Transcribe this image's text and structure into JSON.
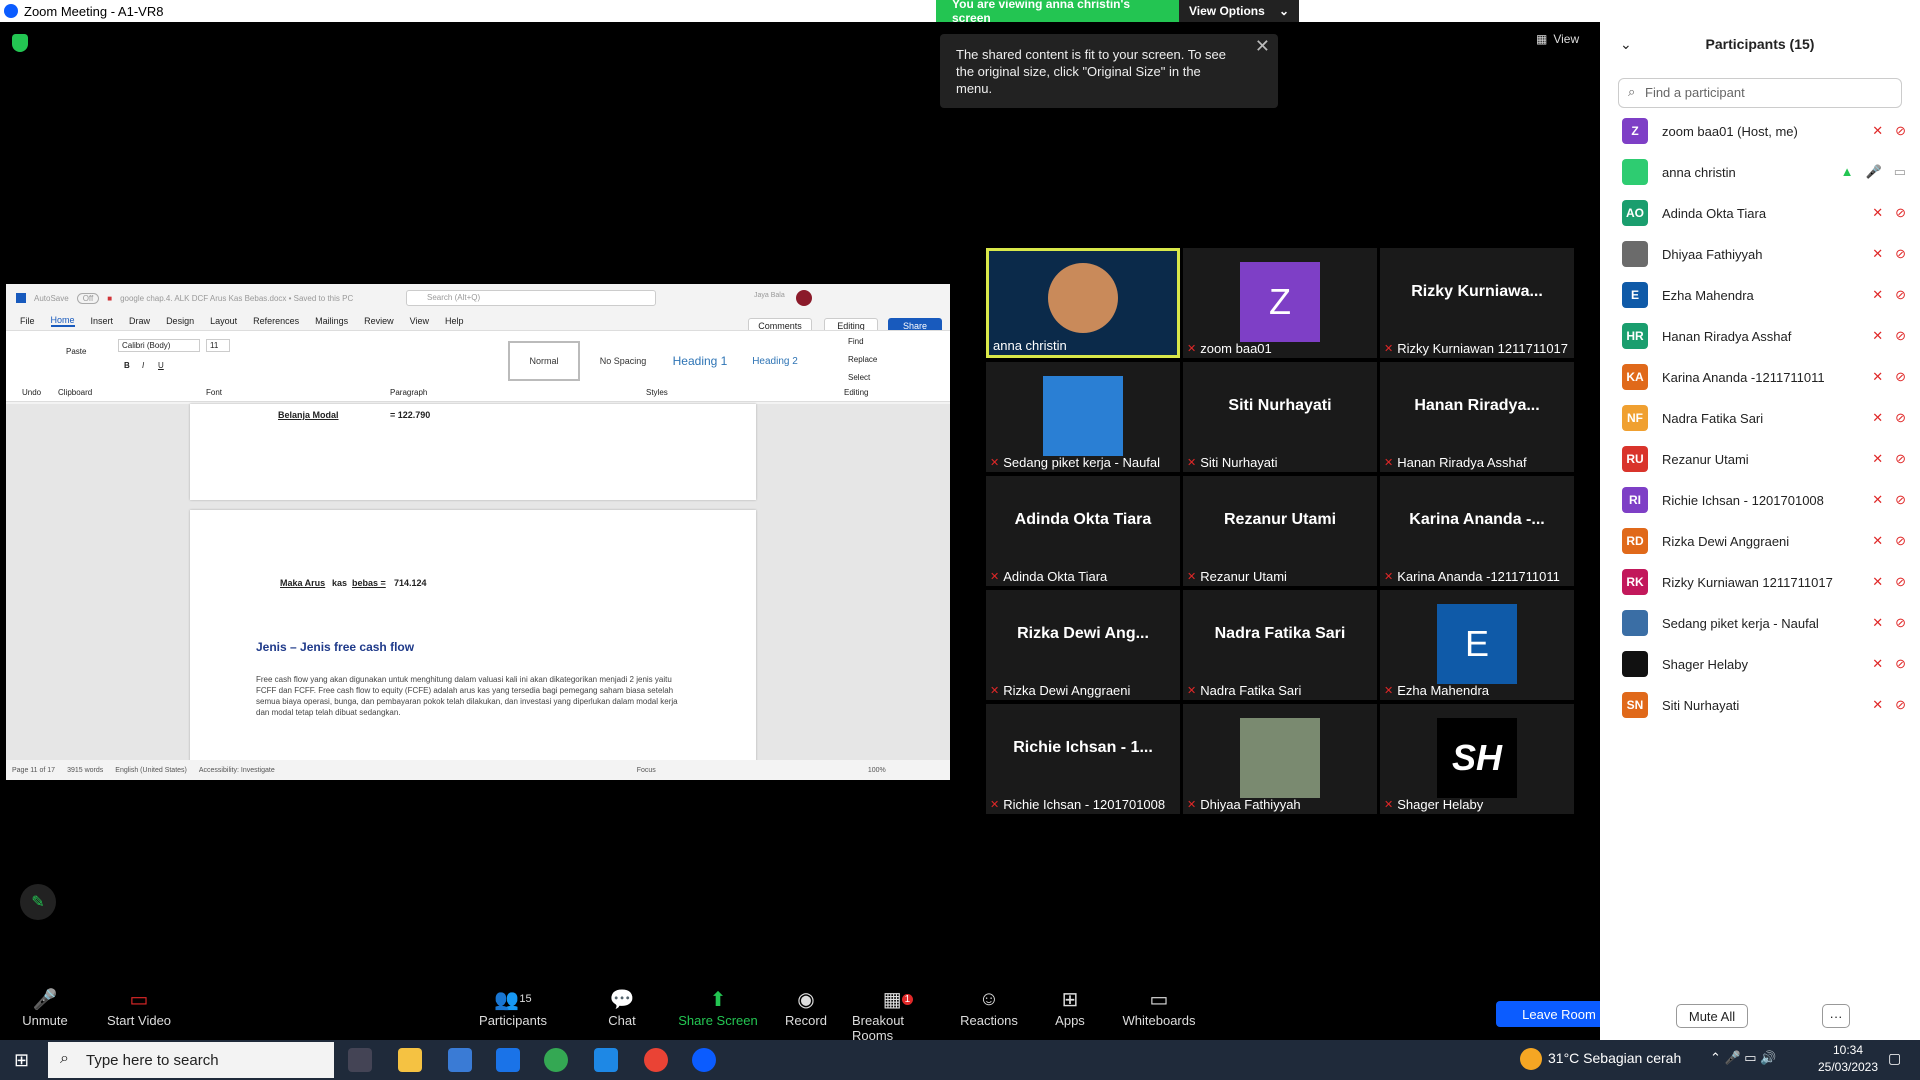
{
  "window": {
    "title": "Zoom Meeting - A1-VR8",
    "minimize": "–",
    "restore": "❐",
    "close": "✕"
  },
  "banner": {
    "viewing": "You are viewing anna christin's screen",
    "options": "View Options"
  },
  "toast": {
    "text": "The shared content is fit to your screen. To see the original size, click \"Original Size\" in the menu."
  },
  "view_label": "View",
  "word": {
    "autosave": "AutoSave",
    "off": "Off",
    "filename": "google chap.4. ALK DCF Arus Kas Bebas.docx • Saved to this PC",
    "search": "Search (Alt+Q)",
    "user": "Jaya Bala",
    "menu": [
      "File",
      "Home",
      "Insert",
      "Draw",
      "Design",
      "Layout",
      "References",
      "Mailings",
      "Review",
      "View",
      "Help"
    ],
    "comments": "Comments",
    "editing": "Editing",
    "share": "Share",
    "font": "Calibri (Body)",
    "size": "11",
    "styles": [
      "Normal",
      "No Spacing",
      "Heading 1",
      "Heading 2"
    ],
    "find": "Find",
    "replace": "Replace",
    "select": "Select",
    "groups": [
      "Undo",
      "Clipboard",
      "Font",
      "Paragraph",
      "Styles",
      "Editing"
    ],
    "paste": "Paste",
    "doc": {
      "line1a": "Belanja Modal",
      "line1b": "= 122.790",
      "line2a": "Maka Arus",
      "line2b": "kas",
      "line2c": "bebas =",
      "line2d": "714.124",
      "heading": "Jenis – Jenis free cash flow",
      "para": "Free cash flow yang akan digunakan untuk menghitung dalam valuasi kali ini akan dikategorikan menjadi 2 jenis yaitu FCFF dan FCFF. Free cash flow to equity (FCFE) adalah arus kas yang tersedia bagi pemegang saham biasa setelah semua biaya operasi, bunga, dan pembayaran pokok telah dilakukan, dan investasi yang diperlukan dalam modal kerja dan modal tetap telah dibuat sedangkan."
    },
    "status": {
      "page": "Page 11 of 17",
      "words": "3915 words",
      "lang": "English (United States)",
      "access": "Accessibility: Investigate",
      "focus": "Focus",
      "zoom": "100%"
    }
  },
  "tiles": [
    {
      "name": "",
      "label": "anna christin",
      "type": "video"
    },
    {
      "name": "",
      "label": "zoom baa01",
      "type": "avatar",
      "initial": "Z",
      "color": "#7e3fc6"
    },
    {
      "name": "Rizky  Kurniawa...",
      "label": "Rizky Kurniawan 1211711017",
      "type": "name"
    },
    {
      "name": "",
      "label": "Sedang piket kerja - Naufal",
      "type": "photo"
    },
    {
      "name": "Siti Nurhayati",
      "label": "Siti Nurhayati",
      "type": "name"
    },
    {
      "name": "Hanan  Riradya...",
      "label": "Hanan Riradya Asshaf",
      "type": "name"
    },
    {
      "name": "Adinda Okta Tiara",
      "label": "Adinda Okta Tiara",
      "type": "name"
    },
    {
      "name": "Rezanur Utami",
      "label": "Rezanur Utami",
      "type": "name"
    },
    {
      "name": "Karina Ananda -...",
      "label": "Karina Ananda -1211711011",
      "type": "name"
    },
    {
      "name": "Rizka  Dewi Ang...",
      "label": "Rizka Dewi Anggraeni",
      "type": "name"
    },
    {
      "name": "Nadra Fatika Sari",
      "label": "Nadra Fatika Sari",
      "type": "name"
    },
    {
      "name": "",
      "label": "Ezha Mahendra",
      "type": "avatar",
      "initial": "E",
      "color": "#0f5aa8"
    },
    {
      "name": "Richie Ichsan - 1...",
      "label": "Richie Ichsan - 1201701008",
      "type": "name"
    },
    {
      "name": "",
      "label": "Dhiyaa Fathiyyah",
      "type": "photo2"
    },
    {
      "name": "",
      "label": "Shager Helaby",
      "type": "logo",
      "initial": "SH"
    }
  ],
  "toolbar": {
    "unmute": "Unmute",
    "start_video": "Start Video",
    "participants": "Participants",
    "participants_count": "15",
    "chat": "Chat",
    "share": "Share Screen",
    "record": "Record",
    "breakout": "Breakout Rooms",
    "breakout_badge": "1",
    "reactions": "Reactions",
    "apps": "Apps",
    "whiteboards": "Whiteboards",
    "leave": "Leave Room"
  },
  "panel": {
    "title": "Participants (15)",
    "find": "Find a participant",
    "mute_all": "Mute All",
    "more": "···",
    "people": [
      {
        "initials": "Z",
        "name": "zoom baa01 (Host, me)",
        "color": "#7e3fc6"
      },
      {
        "initials": "",
        "name": "anna christin",
        "color": "#2ecc71"
      },
      {
        "initials": "AO",
        "name": "Adinda Okta Tiara",
        "color": "#1a9e6e"
      },
      {
        "initials": "",
        "name": "Dhiyaa Fathiyyah",
        "color": "#6b6b6b"
      },
      {
        "initials": "E",
        "name": "Ezha Mahendra",
        "color": "#0f5aa8"
      },
      {
        "initials": "HR",
        "name": "Hanan Riradya Asshaf",
        "color": "#1a9e6e"
      },
      {
        "initials": "KA",
        "name": "Karina Ananda -1211711011",
        "color": "#e0691a"
      },
      {
        "initials": "NF",
        "name": "Nadra Fatika Sari",
        "color": "#f0a030"
      },
      {
        "initials": "RU",
        "name": "Rezanur Utami",
        "color": "#d9342b"
      },
      {
        "initials": "RI",
        "name": "Richie Ichsan - 1201701008",
        "color": "#7e3fc6"
      },
      {
        "initials": "RD",
        "name": "Rizka Dewi Anggraeni",
        "color": "#e0691a"
      },
      {
        "initials": "RK",
        "name": "Rizky Kurniawan 1211711017",
        "color": "#c2185b"
      },
      {
        "initials": "",
        "name": "Sedang piket kerja - Naufal",
        "color": "#3a6ea5"
      },
      {
        "initials": "",
        "name": "Shager Helaby",
        "color": "#111111"
      },
      {
        "initials": "SN",
        "name": "Siti Nurhayati",
        "color": "#e0691a"
      }
    ]
  },
  "taskbar": {
    "search": "Type here to search",
    "weather": "31°C  Sebagian cerah",
    "time": "10:34",
    "date": "25/03/2023"
  }
}
